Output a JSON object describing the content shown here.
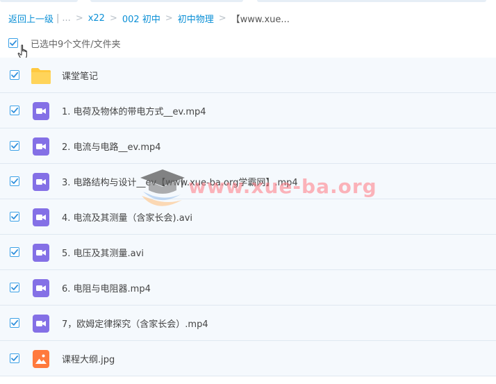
{
  "breadcrumb": {
    "back": "返回上一级",
    "sep": "|",
    "ellipsis": "...",
    "arrow": ">",
    "items": [
      "x22",
      "002 初中",
      "初中物理"
    ],
    "current": "【www.xue..."
  },
  "selection": {
    "label": "已选中9个文件/文件夹"
  },
  "files": [
    {
      "name": "课堂笔记",
      "type": "folder",
      "checked": true
    },
    {
      "name": "1. 电荷及物体的带电方式__ev.mp4",
      "type": "video",
      "checked": true
    },
    {
      "name": "2. 电流与电路__ev.mp4",
      "type": "video",
      "checked": true
    },
    {
      "name": "3. 电路结构与设计__ev【www.xue-ba.org学霸网】.mp4",
      "type": "video",
      "checked": true
    },
    {
      "name": "4. 电流及其测量（含家长会).avi",
      "type": "video",
      "checked": true
    },
    {
      "name": "5. 电压及其测量.avi",
      "type": "video",
      "checked": true
    },
    {
      "name": "6. 电阻与电阻器.mp4",
      "type": "video",
      "checked": true
    },
    {
      "name": "7，欧姆定律探究（含家长会）.mp4",
      "type": "video",
      "checked": true
    },
    {
      "name": "课程大纲.jpg",
      "type": "image",
      "checked": true
    }
  ],
  "watermark": {
    "text": "www.xue-ba.org"
  },
  "colors": {
    "link": "#0a8fd6",
    "checkbox": "#3aa0e6",
    "row_bg": "#f5f9fd",
    "folder": "#ffc940",
    "video": "#8470e6",
    "image": "#ff7a3d"
  }
}
